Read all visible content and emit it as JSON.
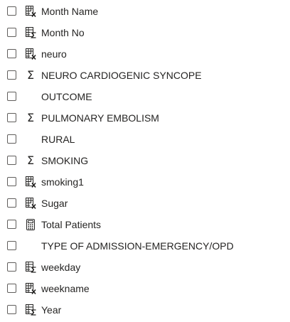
{
  "fields": [
    {
      "label": "Month Name",
      "icon": "calculated-column-icon",
      "checked": false
    },
    {
      "label": "Month No",
      "icon": "calculated-measure-column-icon",
      "checked": false
    },
    {
      "label": "neuro",
      "icon": "calculated-column-icon",
      "checked": false
    },
    {
      "label": "NEURO CARDIOGENIC SYNCOPE",
      "icon": "sigma-icon",
      "checked": false
    },
    {
      "label": "OUTCOME",
      "icon": "",
      "checked": false
    },
    {
      "label": "PULMONARY EMBOLISM",
      "icon": "sigma-icon",
      "checked": false
    },
    {
      "label": "RURAL",
      "icon": "",
      "checked": false
    },
    {
      "label": "SMOKING",
      "icon": "sigma-icon",
      "checked": false
    },
    {
      "label": "smoking1",
      "icon": "calculated-column-icon",
      "checked": false
    },
    {
      "label": "Sugar",
      "icon": "calculated-column-icon",
      "checked": false
    },
    {
      "label": "Total Patients",
      "icon": "calculator-icon",
      "checked": false
    },
    {
      "label": "TYPE OF ADMISSION-EMERGENCY/OPD",
      "icon": "",
      "checked": false
    },
    {
      "label": "weekday",
      "icon": "calculated-measure-column-icon",
      "checked": false
    },
    {
      "label": "weekname",
      "icon": "calculated-column-icon",
      "checked": false
    },
    {
      "label": "Year",
      "icon": "calculated-measure-column-icon",
      "checked": false
    }
  ],
  "colors": {
    "text": "#252423",
    "checkbox_border": "#605e5c",
    "background": "#ffffff"
  }
}
